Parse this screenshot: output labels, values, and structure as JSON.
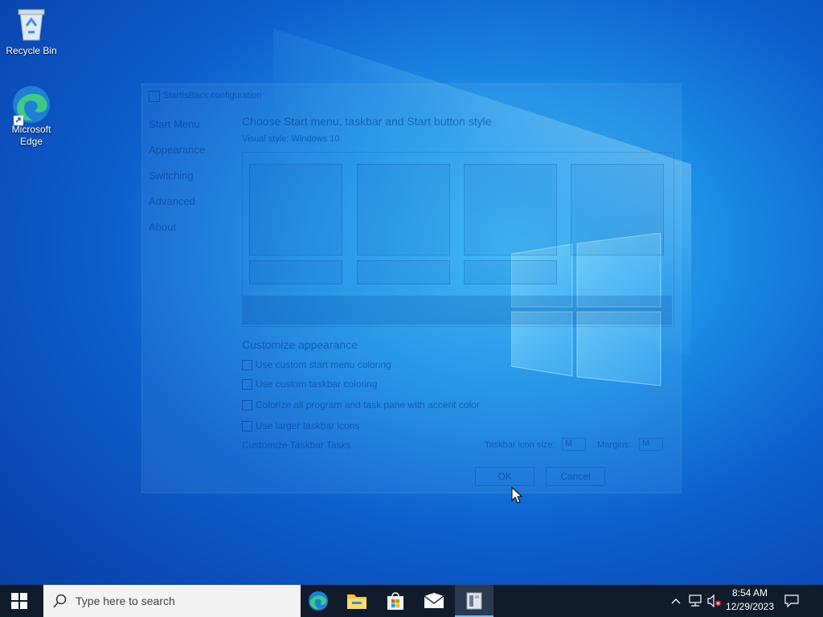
{
  "desktop": {
    "icons": [
      {
        "label": "Recycle Bin",
        "icon": "recycle-bin-icon"
      },
      {
        "label": "Microsoft Edge",
        "icon": "edge-icon"
      }
    ]
  },
  "dialog": {
    "title": "StartIsBack configuration",
    "nav": [
      "Start Menu",
      "Appearance",
      "Switching",
      "Advanced",
      "About"
    ],
    "heading": "Choose Start menu, taskbar and Start button style",
    "visual_style": "Visual style: Windows 10",
    "customize_heading": "Customize appearance",
    "checkboxes": [
      "Use custom start menu coloring",
      "Use custom taskbar coloring",
      "Colorize all program and task pane with accent color",
      "Use larger taskbar icons"
    ],
    "customize_link": "Customize Taskbar Tasks",
    "icon_size_label": "Taskbar icon size:",
    "icon_size_value": "M",
    "margins_label": "Margins:",
    "margins_value": "M",
    "ok": "OK",
    "cancel": "Cancel"
  },
  "taskbar": {
    "search_placeholder": "Type here to search",
    "apps": [
      "edge-icon",
      "file-explorer-icon",
      "store-icon",
      "mail-icon",
      "startisback-config-icon"
    ],
    "active_app": "startisback-config-icon",
    "tray_icons": [
      "chevron-up-icon",
      "network-icon",
      "volume-muted-icon"
    ],
    "time": "8:54 AM",
    "date": "12/29/2023",
    "notification_icon": "action-center-icon"
  },
  "colors": {
    "taskbar": "#101c2c",
    "desktop_accent": "#1c8fe6",
    "active_indicator": "#76b9ed"
  }
}
